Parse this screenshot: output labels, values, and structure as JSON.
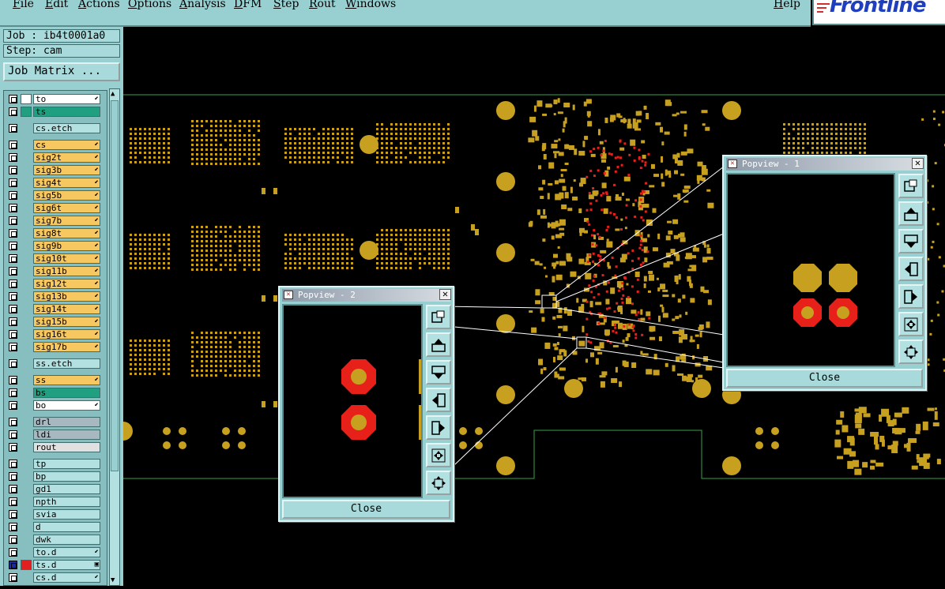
{
  "menu": [
    "File",
    "Edit",
    "Actions",
    "Options",
    "Analysis",
    "DFM",
    "Step",
    "Rout",
    "Windows"
  ],
  "help_label": "Help",
  "logo_text": "Frontline",
  "job_label": "Job : ib4t0001a0",
  "step_label": "Step: cam",
  "job_matrix_label": "Job Matrix ...",
  "layers": [
    {
      "name": "to",
      "color": "#ffffff",
      "sw": "#ffffff",
      "mark": "⬋"
    },
    {
      "name": "ts",
      "color": "#20a080",
      "sw": "#20a080",
      "mark": ""
    },
    {
      "name": "cs.etch",
      "color": "#b3e0e0",
      "sw": "",
      "mark": ""
    },
    {
      "name": "cs",
      "color": "#f7c862",
      "sw": "",
      "mark": "⬋"
    },
    {
      "name": "sig2t",
      "color": "#f7c862",
      "sw": "",
      "mark": "⬋"
    },
    {
      "name": "sig3b",
      "color": "#f7c862",
      "sw": "",
      "mark": "⬋"
    },
    {
      "name": "sig4t",
      "color": "#f7c862",
      "sw": "",
      "mark": "⬋"
    },
    {
      "name": "sig5b",
      "color": "#f7c862",
      "sw": "",
      "mark": "⬋"
    },
    {
      "name": "sig6t",
      "color": "#f7c862",
      "sw": "",
      "mark": "⬋"
    },
    {
      "name": "sig7b",
      "color": "#f7c862",
      "sw": "",
      "mark": "⬋"
    },
    {
      "name": "sig8t",
      "color": "#f7c862",
      "sw": "",
      "mark": "⬋"
    },
    {
      "name": "sig9b",
      "color": "#f7c862",
      "sw": "",
      "mark": "⬋"
    },
    {
      "name": "sig10t",
      "color": "#f7c862",
      "sw": "",
      "mark": "⬋"
    },
    {
      "name": "sig11b",
      "color": "#f7c862",
      "sw": "",
      "mark": "⬋"
    },
    {
      "name": "sig12t",
      "color": "#f7c862",
      "sw": "",
      "mark": "⬋"
    },
    {
      "name": "sig13b",
      "color": "#f7c862",
      "sw": "",
      "mark": "⬋"
    },
    {
      "name": "sig14t",
      "color": "#f7c862",
      "sw": "",
      "mark": "⬋"
    },
    {
      "name": "sig15b",
      "color": "#f7c862",
      "sw": "",
      "mark": "⬋"
    },
    {
      "name": "sig16t",
      "color": "#f7c862",
      "sw": "",
      "mark": "⬋"
    },
    {
      "name": "sig17b",
      "color": "#f7c862",
      "sw": "",
      "mark": "⬋"
    },
    {
      "name": "ss.etch",
      "color": "#b3e0e0",
      "sw": "",
      "mark": ""
    },
    {
      "name": "ss",
      "color": "#f7c862",
      "sw": "",
      "mark": "⬋"
    },
    {
      "name": "bs",
      "color": "#20a080",
      "sw": "",
      "mark": ""
    },
    {
      "name": "bo",
      "color": "#ffffff",
      "sw": "",
      "mark": "⬋"
    },
    {
      "name": "drl",
      "color": "#a8b8c0",
      "sw": "",
      "mark": ""
    },
    {
      "name": "ldi",
      "color": "#a8b8c0",
      "sw": "",
      "mark": ""
    },
    {
      "name": "rout",
      "color": "#e0e0e0",
      "sw": "",
      "mark": ""
    },
    {
      "name": "tp",
      "color": "#b3e0e0",
      "sw": "",
      "mark": ""
    },
    {
      "name": "bp",
      "color": "#b3e0e0",
      "sw": "",
      "mark": ""
    },
    {
      "name": "gd1",
      "color": "#b3e0e0",
      "sw": "",
      "mark": ""
    },
    {
      "name": "npth",
      "color": "#b3e0e0",
      "sw": "",
      "mark": ""
    },
    {
      "name": "svia",
      "color": "#b3e0e0",
      "sw": "",
      "mark": ""
    },
    {
      "name": "d",
      "color": "#b3e0e0",
      "sw": "",
      "mark": ""
    },
    {
      "name": "dwk",
      "color": "#b3e0e0",
      "sw": "",
      "mark": ""
    },
    {
      "name": "to.d",
      "color": "#b3e0e0",
      "sw": "",
      "mark": "⬋"
    },
    {
      "name": "ts.d",
      "color": "#b3e0e0",
      "sw": "#e02020",
      "mark": "▣"
    },
    {
      "name": "cs.d",
      "color": "#b3e0e0",
      "sw": "",
      "mark": "⬋"
    }
  ],
  "popview2": {
    "title": "Popview - 2",
    "close_label": "Close"
  },
  "popview1": {
    "title": "Popview - 1",
    "close_label": "Close"
  },
  "colors": {
    "pad": "#c8a020",
    "highlight_pad": "#e8201a",
    "outline": "#3aa04a",
    "panel": "#98cfd0"
  }
}
